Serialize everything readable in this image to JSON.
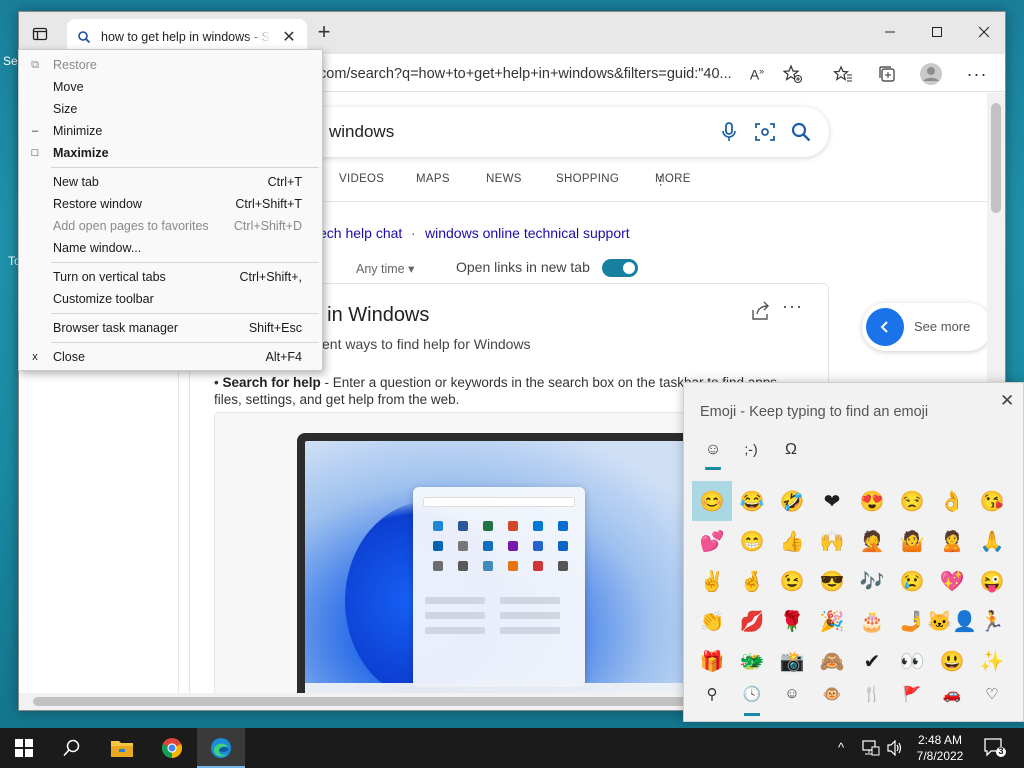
{
  "desktop": {
    "frag1": "Se",
    "frag2": "To"
  },
  "browser": {
    "tab_title": "how to get help in windows - Search",
    "url": "com/search?q=how+to+get+help+in+windows&filters=guid:\"40...",
    "search_query": "windows",
    "nav_tabs": [
      "VIDEOS",
      "MAPS",
      "NEWS",
      "SHOPPING",
      "MORE"
    ],
    "related": [
      "ech help chat",
      "windows online technical support"
    ],
    "related_sep": "·",
    "any_time": "Any time",
    "open_links_label": "Open links in new tab",
    "card_title": "lp in Windows",
    "card_subtitle": "ent ways to find help for Windows",
    "bullet_lead": "Search for help",
    "bullet_text": " - Enter a question or keywords in the search box on the taskbar to find apps, files, settings, and get help from the web.",
    "see_more": "See more"
  },
  "system_menu": {
    "items": [
      {
        "glyph": "⧉",
        "label": "Restore",
        "shortcut": "",
        "disabled": true,
        "bold": false
      },
      {
        "glyph": "",
        "label": "Move",
        "shortcut": "",
        "disabled": false,
        "bold": false
      },
      {
        "glyph": "",
        "label": "Size",
        "shortcut": "",
        "disabled": false,
        "bold": false
      },
      {
        "glyph": "–",
        "label": "Minimize",
        "shortcut": "",
        "disabled": false,
        "bold": false
      },
      {
        "glyph": "□",
        "label": "Maximize",
        "shortcut": "",
        "disabled": false,
        "bold": true
      },
      {
        "glyph": "",
        "label": "New tab",
        "shortcut": "Ctrl+T",
        "disabled": false,
        "bold": false
      },
      {
        "glyph": "",
        "label": "Restore window",
        "shortcut": "Ctrl+Shift+T",
        "disabled": false,
        "bold": false
      },
      {
        "glyph": "",
        "label": "Add open pages to favorites",
        "shortcut": "Ctrl+Shift+D",
        "disabled": true,
        "bold": false
      },
      {
        "glyph": "",
        "label": "Name window...",
        "shortcut": "",
        "disabled": false,
        "bold": false
      },
      {
        "glyph": "",
        "label": "Turn on vertical tabs",
        "shortcut": "Ctrl+Shift+,",
        "disabled": false,
        "bold": false
      },
      {
        "glyph": "",
        "label": "Customize toolbar",
        "shortcut": "",
        "disabled": false,
        "bold": false
      },
      {
        "glyph": "",
        "label": "Browser task manager",
        "shortcut": "Shift+Esc",
        "disabled": false,
        "bold": false
      },
      {
        "glyph": "x",
        "label": "Close",
        "shortcut": "Alt+F4",
        "disabled": false,
        "bold": false
      }
    ]
  },
  "emoji_panel": {
    "prompt": "Emoji - Keep typing to find an emoji",
    "categories": [
      "☺",
      ";-)",
      "Ω"
    ],
    "emojis": [
      "😊",
      "😂",
      "🤣",
      "❤",
      "😍",
      "😒",
      "👌",
      "😘",
      "💕",
      "😁",
      "👍",
      "🙌",
      "🤦",
      "🤷",
      "🙎",
      "🙏",
      "✌",
      "🤞",
      "😉",
      "😎",
      "🎶",
      "😢",
      "💖",
      "😜",
      "👏",
      "💋",
      "🌹",
      "🎉",
      "🎂",
      "🤳",
      "🐱‍👤",
      "🏃",
      "🎁",
      "🐲",
      "📸",
      "🙈",
      "✔",
      "👀",
      "😃",
      "✨"
    ],
    "selected_index": 0,
    "bottom_categories": [
      "⚲",
      "🕓",
      "☺",
      "🐵",
      "🍴",
      "🚩",
      "🚗",
      "♡"
    ],
    "active_bottom_index": 1
  },
  "taskbar": {
    "time": "2:48 AM",
    "date": "7/8/2022",
    "notification_count": "3"
  },
  "colors": {
    "accent": "#1a8aa0",
    "link": "#1a0dab",
    "taskbar": "#1b1b1b",
    "desktop": "#1a8aa3"
  }
}
